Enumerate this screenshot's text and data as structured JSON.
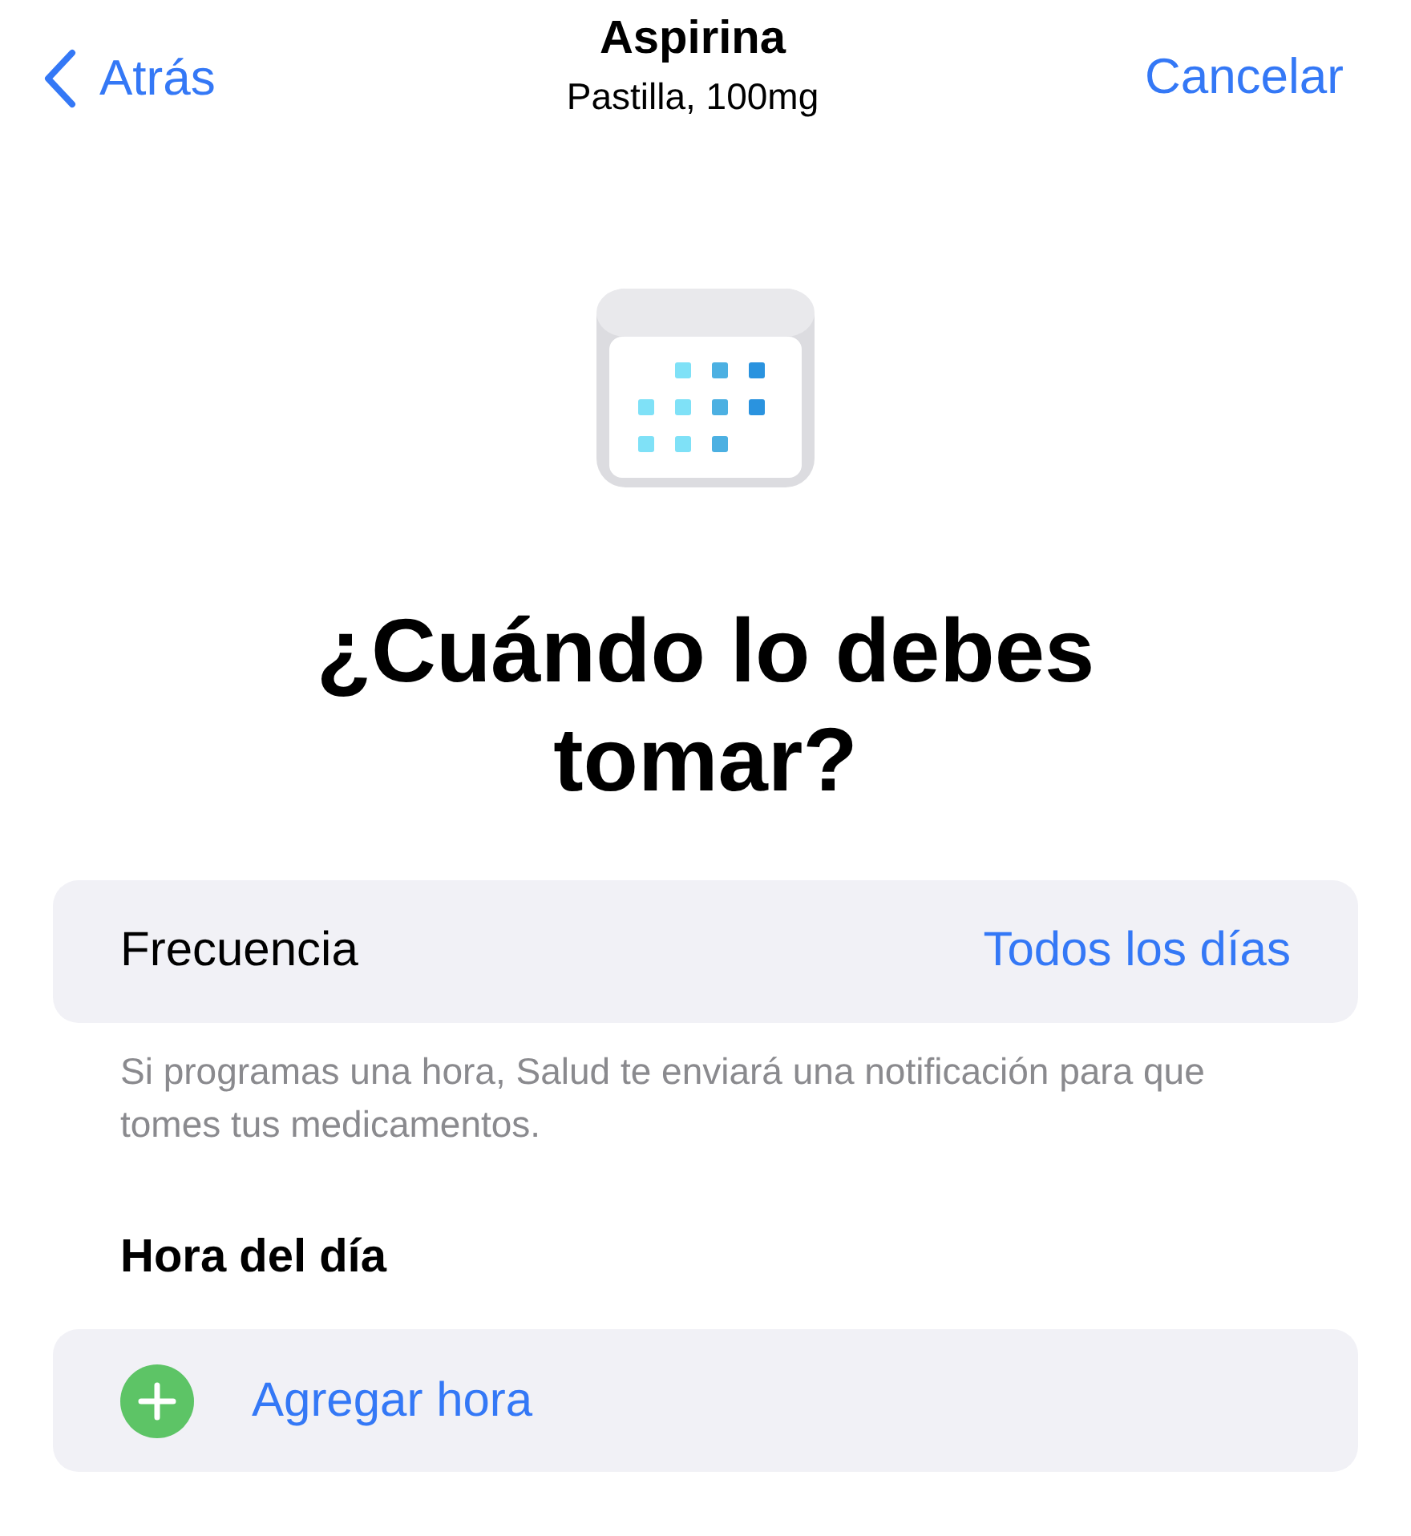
{
  "nav": {
    "back": "Atrás",
    "title": "Aspirina",
    "subtitle": "Pastilla, 100mg",
    "cancel": "Cancelar"
  },
  "heading": "¿Cuándo lo debes tomar?",
  "frequency": {
    "label": "Frecuencia",
    "value": "Todos los días"
  },
  "footnote": "Si programas una hora, Salud te enviará una notificación para que tomes tus medicamentos.",
  "time_section": {
    "title": "Hora del día",
    "add": "Agregar hora"
  }
}
